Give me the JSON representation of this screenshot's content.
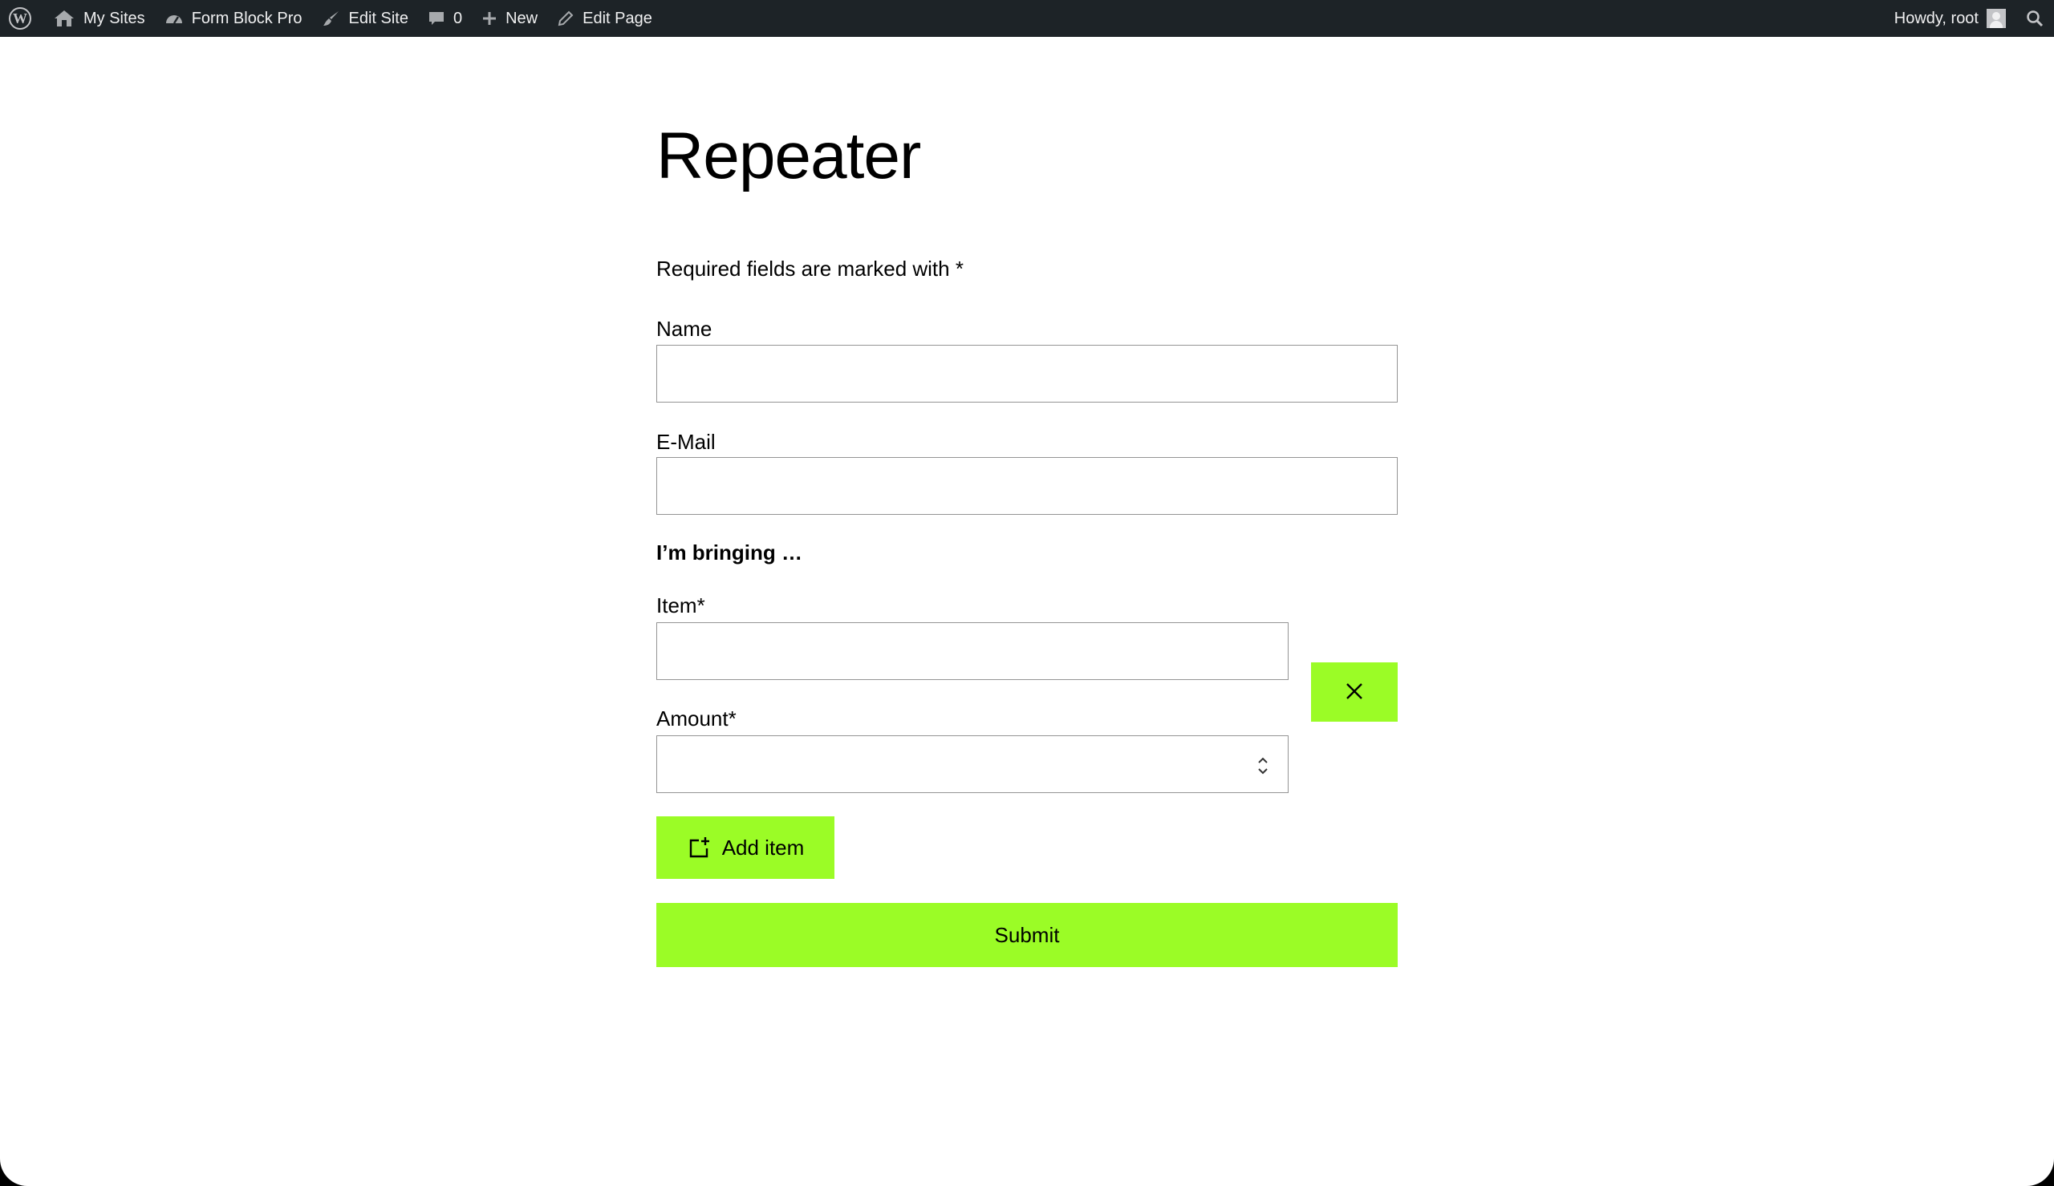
{
  "admin_bar": {
    "my_sites": "My Sites",
    "site_name": "Form Block Pro",
    "edit_site": "Edit Site",
    "comments_count": "0",
    "new": "New",
    "edit_page": "Edit Page",
    "howdy": "Howdy, root"
  },
  "page": {
    "title": "Repeater",
    "required_note": "Required fields are marked with *"
  },
  "form": {
    "name_label": "Name",
    "name_value": "",
    "email_label": "E-Mail",
    "email_value": "",
    "repeater_legend": "I’m bringing …",
    "item_label": "Item*",
    "item_value": "",
    "amount_label": "Amount*",
    "amount_value": "",
    "add_item_label": "Add item",
    "submit_label": "Submit"
  },
  "colors": {
    "accent": "#9bfc26",
    "admin_bar_bg": "#1d2327",
    "input_border": "#949494"
  },
  "icons": {
    "wordpress": "wordpress-logo-icon",
    "my_sites": "my-sites-icon",
    "site": "dashboard-icon",
    "edit_site": "brush-icon",
    "comments": "comment-icon",
    "new": "plus-icon",
    "edit_page": "pencil-icon",
    "search": "search-icon",
    "remove": "close-icon",
    "add_item": "add-item-icon",
    "spinner": "number-spinner-icon"
  }
}
